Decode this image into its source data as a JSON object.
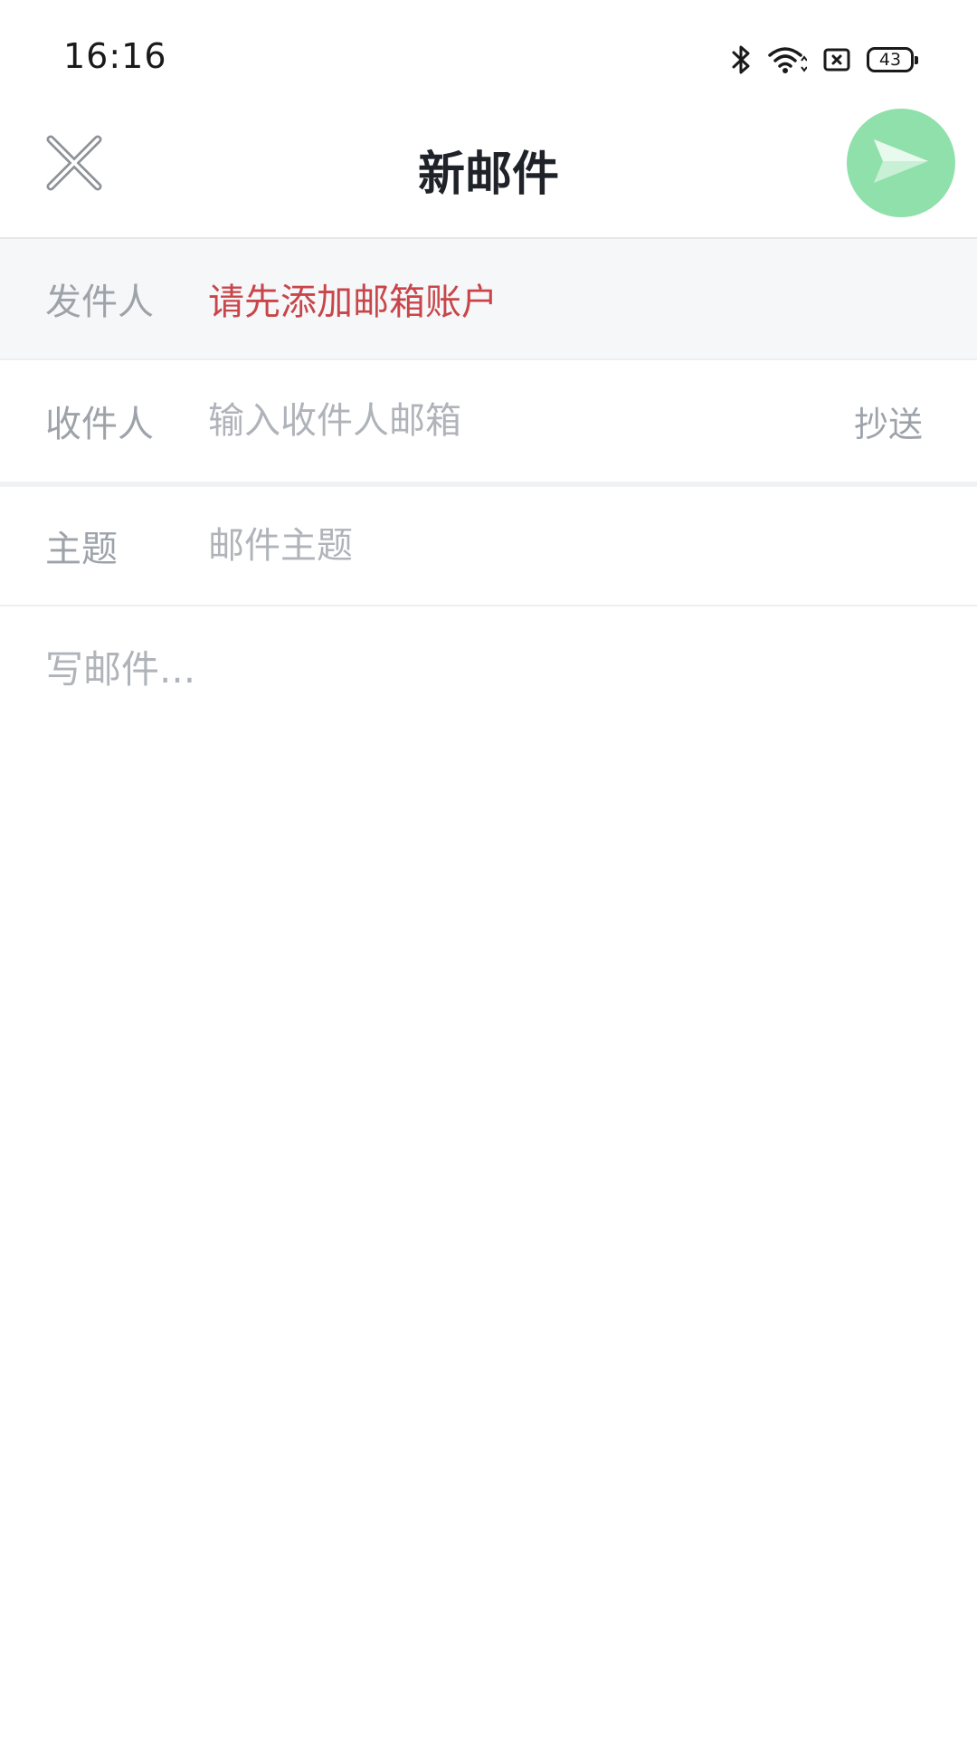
{
  "status_bar": {
    "time": "16:16",
    "battery_level": "43",
    "icons": [
      "bluetooth-icon",
      "wifi-icon",
      "sim-card-icon",
      "battery-icon"
    ]
  },
  "header": {
    "title": "新邮件",
    "close_icon": "close-icon",
    "send_icon": "send-icon",
    "send_button_color": "#90e0ab"
  },
  "compose": {
    "sender": {
      "label": "发件人",
      "value": "请先添加邮箱账户",
      "value_color": "#c8464a"
    },
    "recipient": {
      "label": "收件人",
      "placeholder": "输入收件人邮箱",
      "value": "",
      "cc_label": "抄送"
    },
    "subject": {
      "label": "主题",
      "placeholder": "邮件主题",
      "value": ""
    },
    "body": {
      "placeholder": "写邮件...",
      "value": ""
    }
  }
}
